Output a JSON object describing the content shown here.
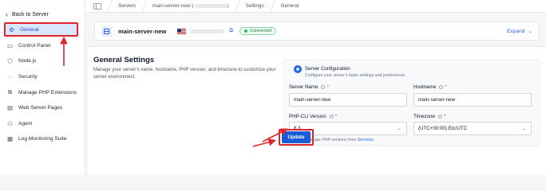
{
  "sidebar": {
    "back_label": "Back to Server",
    "items": [
      {
        "label": "General",
        "icon": "settings-icon",
        "active": true
      },
      {
        "label": "Control Panel",
        "icon": "control-panel-icon"
      },
      {
        "label": "Node.js",
        "icon": "nodejs-icon"
      },
      {
        "label": "Security",
        "icon": "shield-icon"
      },
      {
        "label": "Manage PHP Extensions",
        "icon": "php-extensions-icon"
      },
      {
        "label": "Web Server Pages",
        "icon": "web-pages-icon"
      },
      {
        "label": "Agent",
        "icon": "agent-icon"
      },
      {
        "label": "Log Monitoring Suite",
        "icon": "log-monitoring-icon"
      }
    ]
  },
  "topbar": {
    "crumbs": [
      "Servers",
      "main-server-new (",
      ")",
      "Settings",
      "General"
    ]
  },
  "server": {
    "name": "main-server-new",
    "status": "Connected",
    "expand_label": "Expand"
  },
  "general": {
    "title": "General Settings",
    "description": "Manage your server's name, hostname, PHP version, and timezone to customize your server environment."
  },
  "config": {
    "title": "Server Configuration",
    "subtitle": "Configure your server's basic settings and preferences",
    "server_name": {
      "label": "Server Name",
      "value": "main-server-new"
    },
    "hostname": {
      "label": "Hostname",
      "value": "main-server-new"
    },
    "php_cli": {
      "label": "PHP-CLI Version",
      "value": "8.3"
    },
    "timezone": {
      "label": "Timezone",
      "value": "(UTC+00:00) Etc/UTC"
    },
    "hint_text": "Install or manage PHP versions from",
    "hint_link": "Services",
    "hint_end": ".",
    "update_label": "Update"
  },
  "colors": {
    "accent": "#1a5cd8",
    "annotation": "#e1242b",
    "status_green": "#22c55e"
  }
}
